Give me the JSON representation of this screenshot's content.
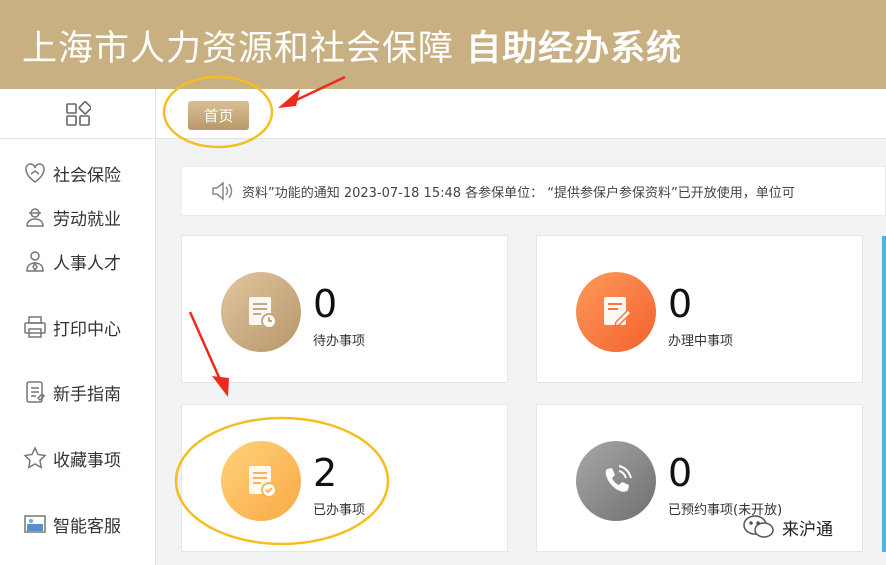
{
  "header": {
    "title_main": "上海市人力资源和社会保障 ",
    "title_bold": "自助经办系统"
  },
  "tabs": {
    "home": "首页"
  },
  "sidebar": {
    "items": [
      {
        "label": "社会保险",
        "icon": "social-insurance-icon"
      },
      {
        "label": "劳动就业",
        "icon": "employment-icon"
      },
      {
        "label": "人事人才",
        "icon": "talent-icon"
      },
      {
        "label": "打印中心",
        "icon": "printer-icon"
      },
      {
        "label": "新手指南",
        "icon": "guide-icon"
      },
      {
        "label": "收藏事项",
        "icon": "star-icon"
      },
      {
        "label": "智能客服",
        "icon": "customer-service-icon"
      }
    ]
  },
  "notice": {
    "text": "资料”功能的通知 2023-07-18 15:48 各参保单位：  “提供参保户参保资料”已开放使用，单位可"
  },
  "cards": [
    {
      "count": "0",
      "label": "待办事项",
      "color": "#c9a77c"
    },
    {
      "count": "0",
      "label": "办理中事项",
      "color": "#f7773e"
    },
    {
      "count": "2",
      "label": "已办事项",
      "color": "#fbbd5c"
    },
    {
      "count": "0",
      "label": "已预约事项(未开放)",
      "color": "#8f8f8f"
    }
  ],
  "watermark": {
    "text": "来沪通"
  },
  "colors": {
    "header": "#c8b083",
    "annotation_ring": "#f4be20",
    "annotation_arrow": "#ee2a1c"
  }
}
